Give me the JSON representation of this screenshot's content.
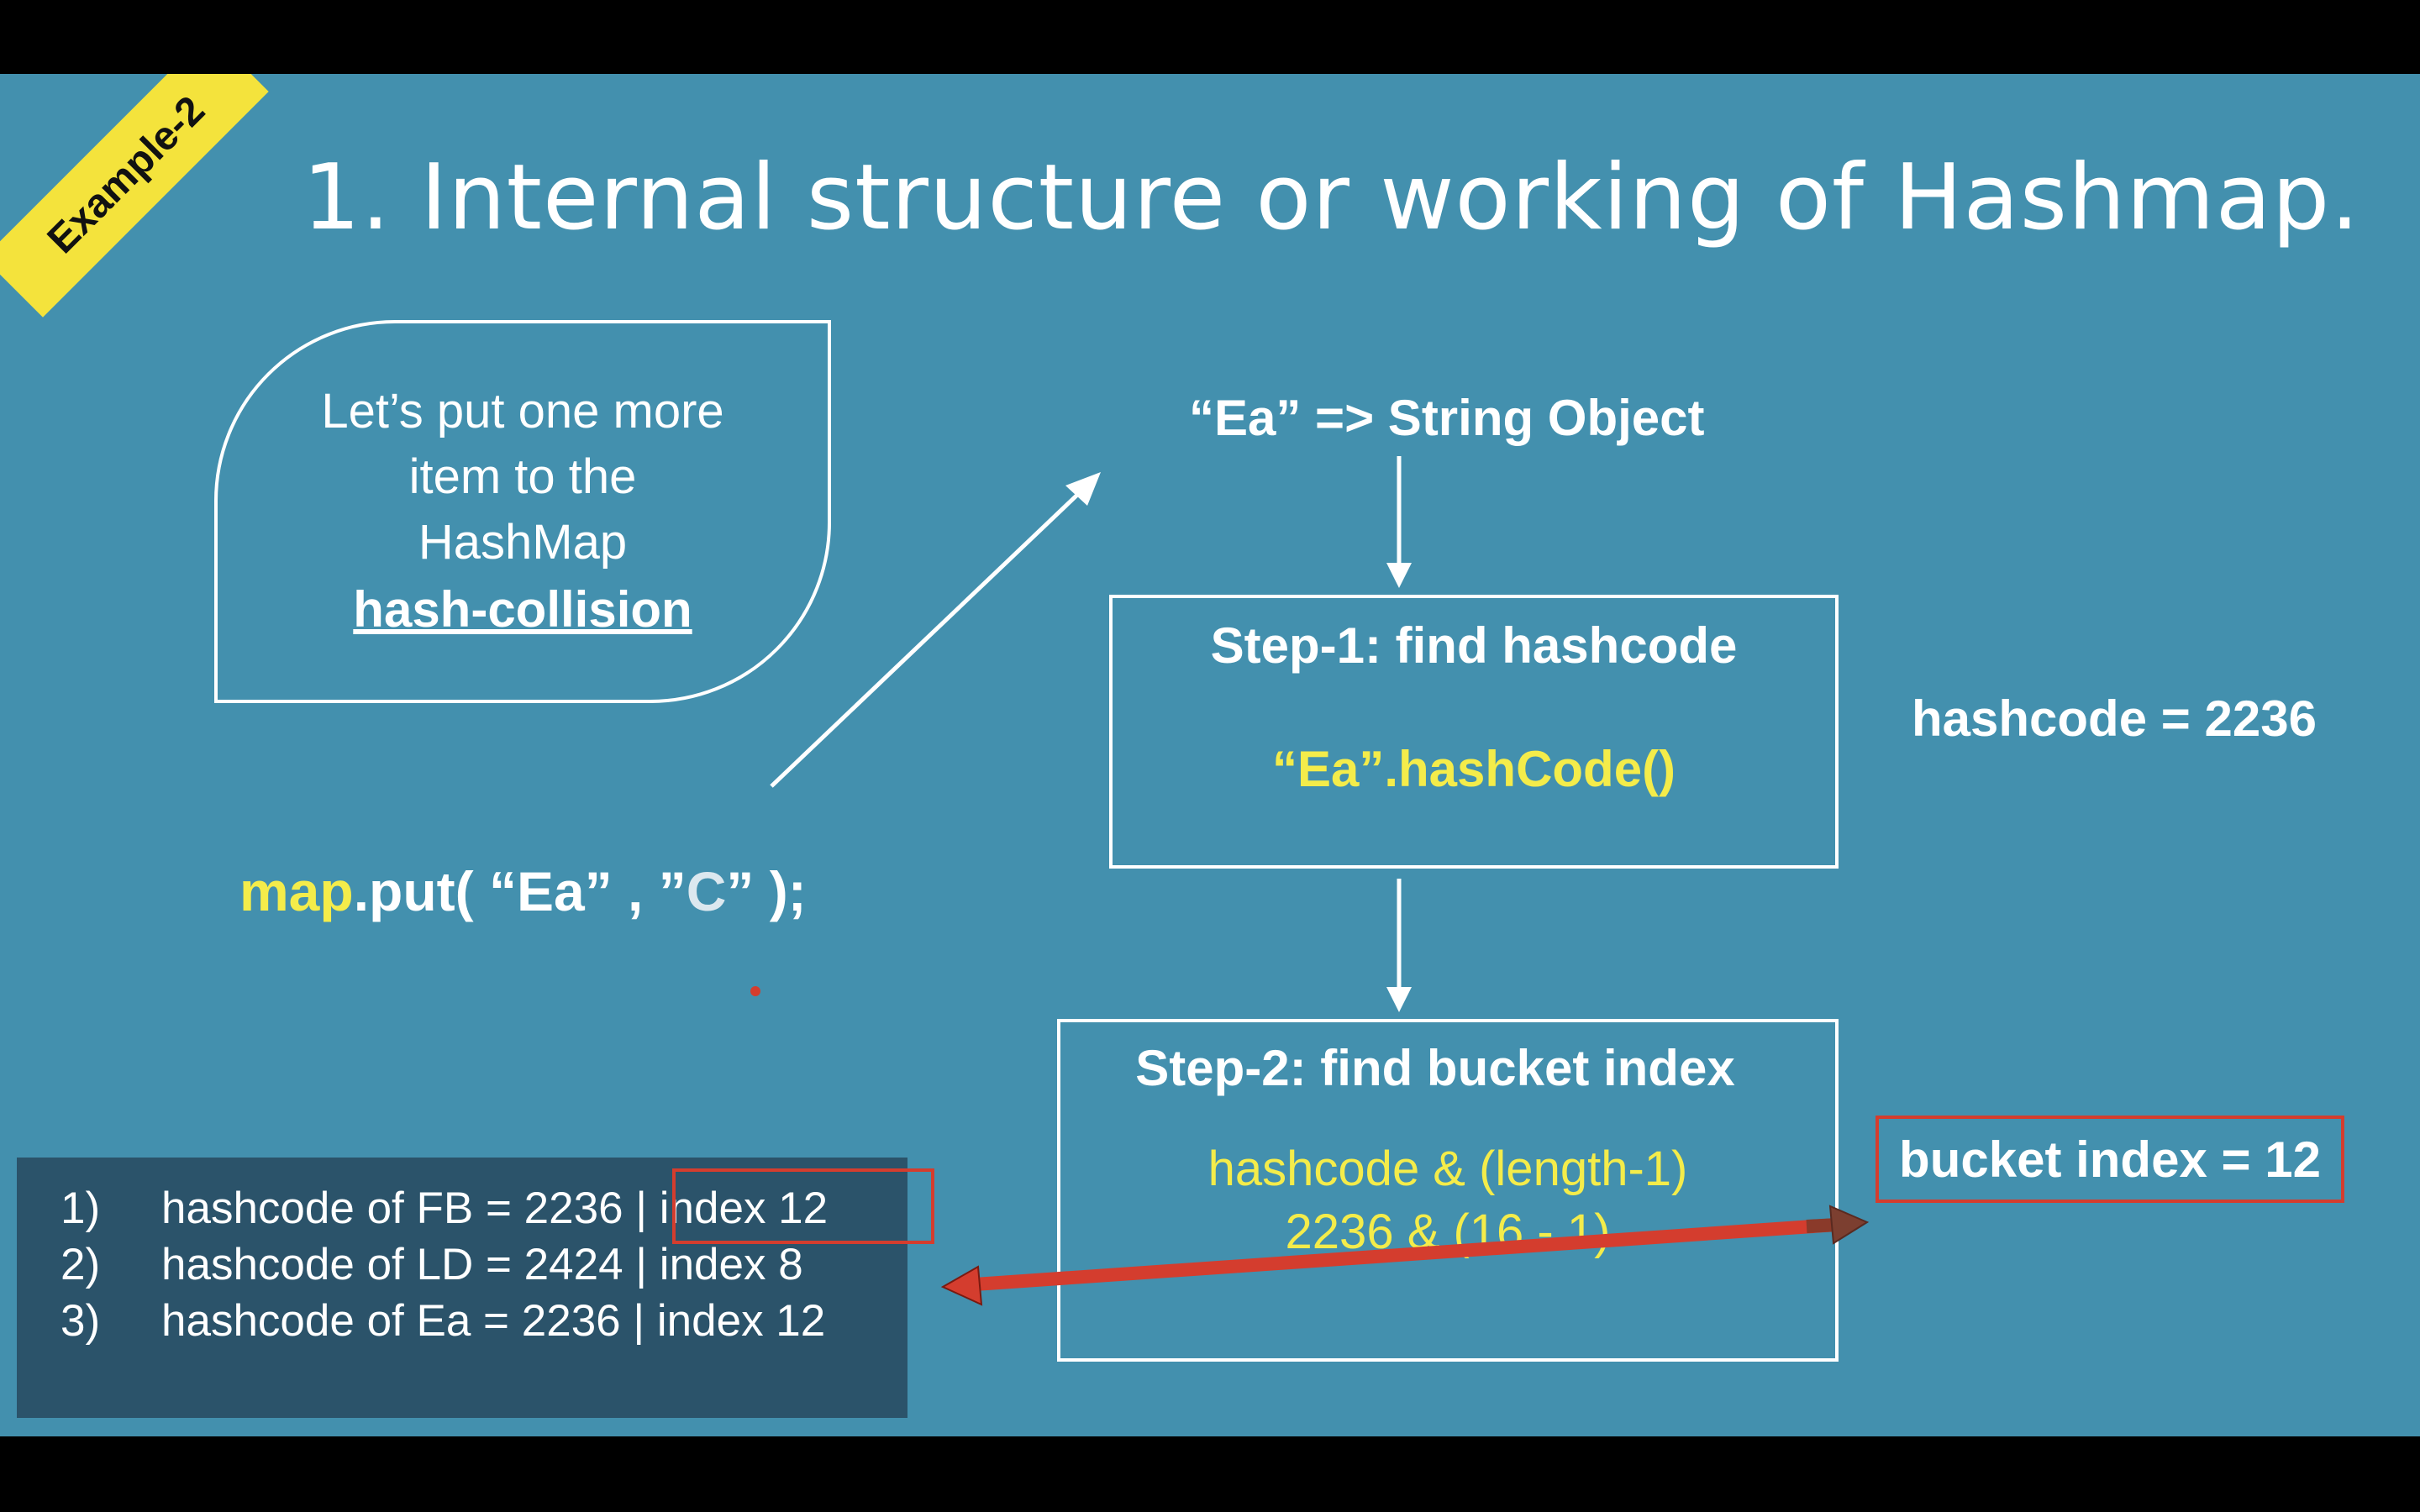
{
  "badge": "Example-2",
  "title": "1.   Internal structure or working of Hashmap.",
  "bubble": {
    "line1": "Let’s put one more",
    "line2": "item to the",
    "line3": "HashMap",
    "line4": "hash-collision"
  },
  "code": {
    "keyword": "map",
    "method": ".put( “Ea” , ”",
    "value": "C",
    "end": "” );"
  },
  "flow": {
    "object_label": "“Ea” => String Object",
    "step1_title": "Step-1: find hashcode",
    "step1_code": "“Ea”.hashCode()",
    "step2_title": "Step-2: find bucket index",
    "step2_formula": "hashcode & (length-1)",
    "step2_calc": "2236  &  (16 - 1)"
  },
  "results": {
    "hashcode": "hashcode = 2236",
    "bucket_index": "bucket index = 12"
  },
  "table": [
    {
      "num": "1)",
      "text": "hashcode of FB = 2236 ",
      "idx": "| index 12"
    },
    {
      "num": "2)",
      "text": "hashcode of LD = 2424 ",
      "idx": "| index  8"
    },
    {
      "num": "3)",
      "text": "hashcode of Ea = 2236 ",
      "idx": "| index 12"
    }
  ],
  "colors": {
    "slide_bg": "#4390ae",
    "highlight_yellow": "#f4ec4a",
    "badge_yellow": "#f4e33c",
    "panel_bg": "#2b536a",
    "arrow_red": "#d43d2e"
  }
}
